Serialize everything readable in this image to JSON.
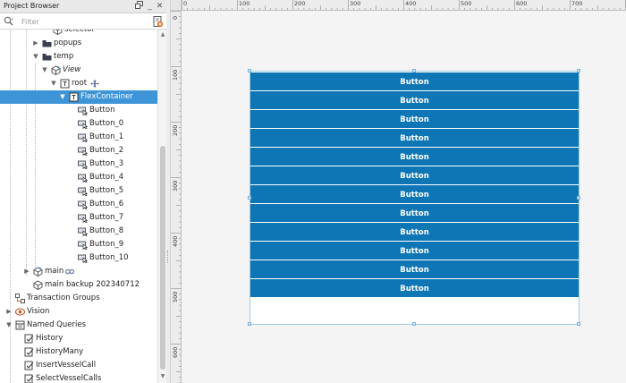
{
  "browser": {
    "title": "Project Browser",
    "search": {
      "placeholder": "Filter"
    },
    "tree": [
      {
        "label": "selector",
        "icon": "view-icon"
      },
      {
        "label": "popups",
        "icon": "folder-icon"
      },
      {
        "label": "temp",
        "icon": "folder-icon"
      },
      {
        "label": "View",
        "icon": "view-icon"
      },
      {
        "label": "root",
        "icon": "container-icon"
      },
      {
        "label": "FlexContainer",
        "icon": "container-icon"
      },
      {
        "label": "Button",
        "icon": "button-icon"
      },
      {
        "label": "Button_0",
        "icon": "button-icon"
      },
      {
        "label": "Button_1",
        "icon": "button-icon"
      },
      {
        "label": "Button_2",
        "icon": "button-icon"
      },
      {
        "label": "Button_3",
        "icon": "button-icon"
      },
      {
        "label": "Button_4",
        "icon": "button-icon"
      },
      {
        "label": "Button_5",
        "icon": "button-icon"
      },
      {
        "label": "Button_6",
        "icon": "button-icon"
      },
      {
        "label": "Button_7",
        "icon": "button-icon"
      },
      {
        "label": "Button_8",
        "icon": "button-icon"
      },
      {
        "label": "Button_9",
        "icon": "button-icon"
      },
      {
        "label": "Button_10",
        "icon": "button-icon"
      },
      {
        "label": "main",
        "icon": "view-icon"
      },
      {
        "label": "main backup 202340712",
        "icon": "view-icon"
      },
      {
        "label": "Transaction Groups",
        "icon": "transaction-groups-icon"
      },
      {
        "label": "Vision",
        "icon": "vision-icon"
      },
      {
        "label": "Named Queries",
        "icon": "named-queries-icon"
      },
      {
        "label": "History",
        "icon": "query-icon"
      },
      {
        "label": "HistoryMany",
        "icon": "query-icon"
      },
      {
        "label": "InsertVesselCall",
        "icon": "query-icon"
      },
      {
        "label": "SelectVesselCalls",
        "icon": "query-icon"
      }
    ]
  },
  "designer": {
    "ruler_x": [
      "0",
      "100",
      "200",
      "300",
      "400",
      "500",
      "600",
      "700"
    ],
    "ruler_y": [
      "0",
      "100",
      "200",
      "300",
      "400",
      "500",
      "600"
    ],
    "buttons": [
      "Button",
      "Button",
      "Button",
      "Button",
      "Button",
      "Button",
      "Button",
      "Button",
      "Button",
      "Button",
      "Button",
      "Button"
    ]
  },
  "colors": {
    "button_bg": "#0e76b4",
    "selection": "#3d94d6"
  }
}
